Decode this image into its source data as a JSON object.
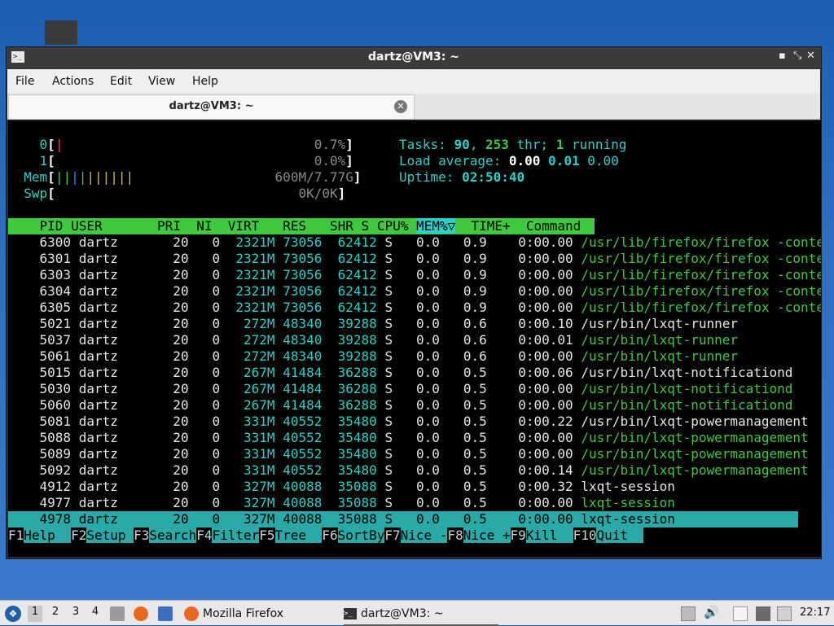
{
  "window": {
    "title": "dartz@VM3: ~",
    "controls": {
      "minimize": "▪",
      "maximize": "⤡",
      "close": "✕"
    }
  },
  "menu": [
    "File",
    "Actions",
    "Edit",
    "View",
    "Help"
  ],
  "tab": {
    "label": "dartz@VM3: ~"
  },
  "htop": {
    "cpu0_label": "0",
    "cpu0_value": "0.7%",
    "cpu1_label": "1",
    "cpu1_value": "0.0%",
    "mem_label": "Mem",
    "mem_value": "600M/7.77G",
    "swp_label": "Swp",
    "swp_value": "0K/0K",
    "tasks_label": "Tasks:",
    "tasks_count": "90",
    "threads": "253",
    "thr_label": "thr;",
    "running": "1",
    "running_label": "running",
    "load_label": "Load average:",
    "load1": "0.00",
    "load5": "0.01",
    "load15": "0.00",
    "uptime_label": "Uptime:",
    "uptime": "02:50:40",
    "columns": [
      "PID",
      "USER",
      "PRI",
      "NI",
      "VIRT",
      "RES",
      "SHR",
      "S",
      "CPU%",
      "MEM%▽",
      "TIME+",
      "Command"
    ],
    "processes": [
      {
        "pid": "6300",
        "user": "dartz",
        "pri": "20",
        "ni": "0",
        "virt": "2321M",
        "res": "73056",
        "shr": "62412",
        "s": "S",
        "cpu": "0.0",
        "mem": "0.9",
        "time": "0:00.00",
        "cmd": "/usr/lib/firefox/firefox -conten",
        "thread": true
      },
      {
        "pid": "6301",
        "user": "dartz",
        "pri": "20",
        "ni": "0",
        "virt": "2321M",
        "res": "73056",
        "shr": "62412",
        "s": "S",
        "cpu": "0.0",
        "mem": "0.9",
        "time": "0:00.00",
        "cmd": "/usr/lib/firefox/firefox -conten",
        "thread": true
      },
      {
        "pid": "6303",
        "user": "dartz",
        "pri": "20",
        "ni": "0",
        "virt": "2321M",
        "res": "73056",
        "shr": "62412",
        "s": "S",
        "cpu": "0.0",
        "mem": "0.9",
        "time": "0:00.00",
        "cmd": "/usr/lib/firefox/firefox -conten",
        "thread": true
      },
      {
        "pid": "6304",
        "user": "dartz",
        "pri": "20",
        "ni": "0",
        "virt": "2321M",
        "res": "73056",
        "shr": "62412",
        "s": "S",
        "cpu": "0.0",
        "mem": "0.9",
        "time": "0:00.00",
        "cmd": "/usr/lib/firefox/firefox -conten",
        "thread": true
      },
      {
        "pid": "6305",
        "user": "dartz",
        "pri": "20",
        "ni": "0",
        "virt": "2321M",
        "res": "73056",
        "shr": "62412",
        "s": "S",
        "cpu": "0.0",
        "mem": "0.9",
        "time": "0:00.00",
        "cmd": "/usr/lib/firefox/firefox -conten",
        "thread": true
      },
      {
        "pid": "5021",
        "user": "dartz",
        "pri": "20",
        "ni": "0",
        "virt": "272M",
        "res": "48340",
        "shr": "39288",
        "s": "S",
        "cpu": "0.0",
        "mem": "0.6",
        "time": "0:00.10",
        "cmd": "/usr/bin/lxqt-runner",
        "thread": false
      },
      {
        "pid": "5037",
        "user": "dartz",
        "pri": "20",
        "ni": "0",
        "virt": "272M",
        "res": "48340",
        "shr": "39288",
        "s": "S",
        "cpu": "0.0",
        "mem": "0.6",
        "time": "0:00.01",
        "cmd": "/usr/bin/lxqt-runner",
        "thread": true
      },
      {
        "pid": "5061",
        "user": "dartz",
        "pri": "20",
        "ni": "0",
        "virt": "272M",
        "res": "48340",
        "shr": "39288",
        "s": "S",
        "cpu": "0.0",
        "mem": "0.6",
        "time": "0:00.00",
        "cmd": "/usr/bin/lxqt-runner",
        "thread": true
      },
      {
        "pid": "5015",
        "user": "dartz",
        "pri": "20",
        "ni": "0",
        "virt": "267M",
        "res": "41484",
        "shr": "36288",
        "s": "S",
        "cpu": "0.0",
        "mem": "0.5",
        "time": "0:00.06",
        "cmd": "/usr/bin/lxqt-notificationd",
        "thread": false
      },
      {
        "pid": "5030",
        "user": "dartz",
        "pri": "20",
        "ni": "0",
        "virt": "267M",
        "res": "41484",
        "shr": "36288",
        "s": "S",
        "cpu": "0.0",
        "mem": "0.5",
        "time": "0:00.00",
        "cmd": "/usr/bin/lxqt-notificationd",
        "thread": true
      },
      {
        "pid": "5060",
        "user": "dartz",
        "pri": "20",
        "ni": "0",
        "virt": "267M",
        "res": "41484",
        "shr": "36288",
        "s": "S",
        "cpu": "0.0",
        "mem": "0.5",
        "time": "0:00.00",
        "cmd": "/usr/bin/lxqt-notificationd",
        "thread": true
      },
      {
        "pid": "5081",
        "user": "dartz",
        "pri": "20",
        "ni": "0",
        "virt": "331M",
        "res": "40552",
        "shr": "35480",
        "s": "S",
        "cpu": "0.0",
        "mem": "0.5",
        "time": "0:00.22",
        "cmd": "/usr/bin/lxqt-powermanagement",
        "thread": false
      },
      {
        "pid": "5088",
        "user": "dartz",
        "pri": "20",
        "ni": "0",
        "virt": "331M",
        "res": "40552",
        "shr": "35480",
        "s": "S",
        "cpu": "0.0",
        "mem": "0.5",
        "time": "0:00.00",
        "cmd": "/usr/bin/lxqt-powermanagement",
        "thread": true
      },
      {
        "pid": "5089",
        "user": "dartz",
        "pri": "20",
        "ni": "0",
        "virt": "331M",
        "res": "40552",
        "shr": "35480",
        "s": "S",
        "cpu": "0.0",
        "mem": "0.5",
        "time": "0:00.00",
        "cmd": "/usr/bin/lxqt-powermanagement",
        "thread": true
      },
      {
        "pid": "5092",
        "user": "dartz",
        "pri": "20",
        "ni": "0",
        "virt": "331M",
        "res": "40552",
        "shr": "35480",
        "s": "S",
        "cpu": "0.0",
        "mem": "0.5",
        "time": "0:00.14",
        "cmd": "/usr/bin/lxqt-powermanagement",
        "thread": true
      },
      {
        "pid": "4912",
        "user": "dartz",
        "pri": "20",
        "ni": "0",
        "virt": "327M",
        "res": "40088",
        "shr": "35088",
        "s": "S",
        "cpu": "0.0",
        "mem": "0.5",
        "time": "0:00.32",
        "cmd": "lxqt-session",
        "thread": false
      },
      {
        "pid": "4977",
        "user": "dartz",
        "pri": "20",
        "ni": "0",
        "virt": "327M",
        "res": "40088",
        "shr": "35088",
        "s": "S",
        "cpu": "0.0",
        "mem": "0.5",
        "time": "0:00.00",
        "cmd": "lxqt-session",
        "thread": true
      },
      {
        "pid": "4978",
        "user": "dartz",
        "pri": "20",
        "ni": "0",
        "virt": "327M",
        "res": "40088",
        "shr": "35088",
        "s": "S",
        "cpu": "0.0",
        "mem": "0.5",
        "time": "0:00.00",
        "cmd": "lxqt-session",
        "thread": true,
        "selected": true
      }
    ],
    "fkeys": [
      {
        "key": "F1",
        "label": "Help  "
      },
      {
        "key": "F2",
        "label": "Setup "
      },
      {
        "key": "F3",
        "label": "Search"
      },
      {
        "key": "F4",
        "label": "Filter"
      },
      {
        "key": "F5",
        "label": "Tree  "
      },
      {
        "key": "F6",
        "label": "SortBy"
      },
      {
        "key": "F7",
        "label": "Nice -"
      },
      {
        "key": "F8",
        "label": "Nice +"
      },
      {
        "key": "F9",
        "label": "Kill  "
      },
      {
        "key": "F10",
        "label": "Quit  "
      }
    ]
  },
  "taskbar": {
    "workspaces": [
      "1",
      "2",
      "3",
      "4"
    ],
    "firefox_label": "Mozilla Firefox",
    "terminal_label": "dartz@VM3: ~",
    "clock": "22:17"
  },
  "colors": {
    "desktop": "#2f6fc0",
    "terminal_bg": "#000000",
    "htop_green": "#3ec93e",
    "htop_cyan": "#2ecfc8"
  }
}
